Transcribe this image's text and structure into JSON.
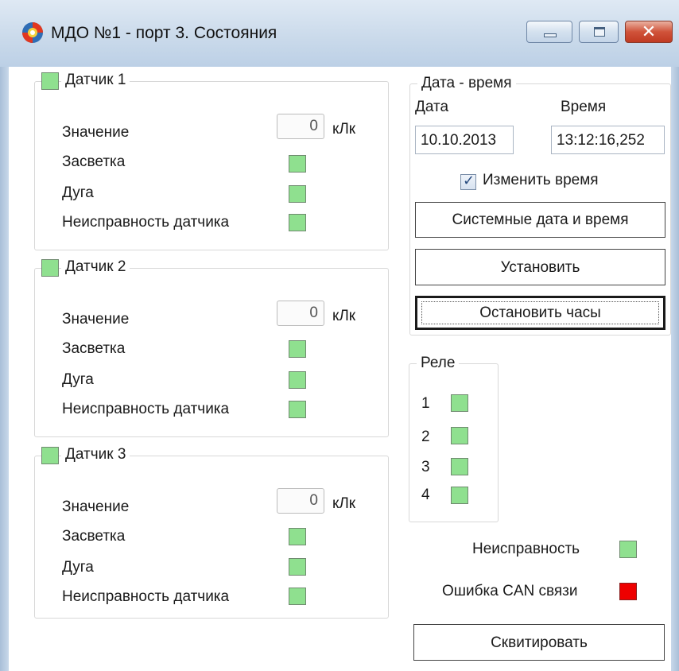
{
  "window": {
    "title": "МДО №1 - порт 3. Состояния",
    "icon": "app-gear-icon",
    "close_glyph": "✕"
  },
  "sensors": [
    {
      "legend": "Датчик 1",
      "value_label": "Значение",
      "value": "0",
      "unit": "кЛк",
      "illumination_label": "Засветка",
      "arc_label": "Дуга",
      "fault_label": "Неисправность датчика"
    },
    {
      "legend": "Датчик 2",
      "value_label": "Значение",
      "value": "0",
      "unit": "кЛк",
      "illumination_label": "Засветка",
      "arc_label": "Дуга",
      "fault_label": "Неисправность датчика"
    },
    {
      "legend": "Датчик 3",
      "value_label": "Значение",
      "value": "0",
      "unit": "кЛк",
      "illumination_label": "Засветка",
      "arc_label": "Дуга",
      "fault_label": "Неисправность датчика"
    }
  ],
  "datetime": {
    "legend": "Дата - время",
    "date_label": "Дата",
    "time_label": "Время",
    "date_value": "10.10.2013",
    "time_value": "13:12:16,252",
    "change_time_label": "Изменить время",
    "change_time_checked": true,
    "system_button": "Системные дата и время",
    "set_button": "Установить",
    "stop_button": "Остановить часы"
  },
  "relays": {
    "legend": "Реле",
    "items": [
      "1",
      "2",
      "3",
      "4"
    ]
  },
  "status": {
    "fault_label": "Неисправность",
    "can_error_label": "Ошибка CAN связи"
  },
  "acknowledge_button": "Сквитировать",
  "colors": {
    "indicator_ok": "#8fe08f",
    "indicator_error": "#ee0000"
  }
}
